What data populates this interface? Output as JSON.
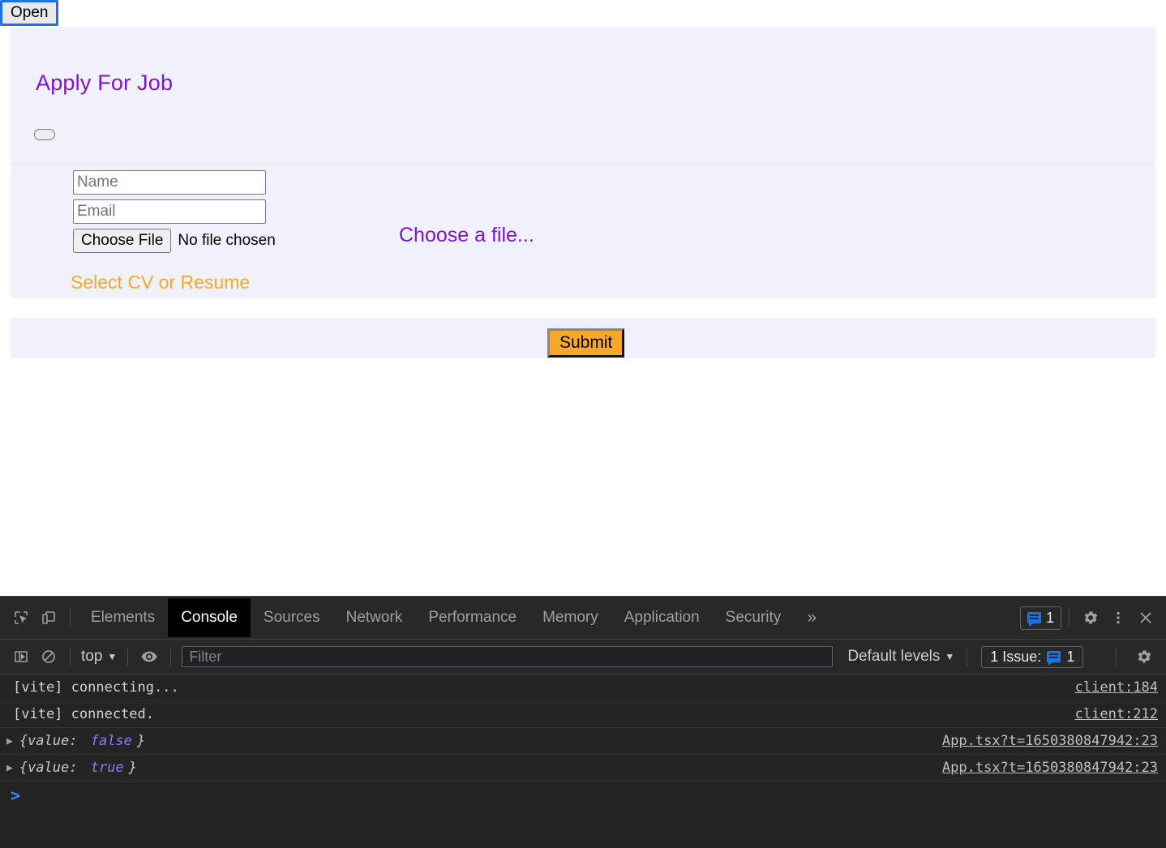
{
  "page": {
    "open_button": "Open",
    "modal": {
      "title": "Apply For Job",
      "pill_button_label": "",
      "name_placeholder": "Name",
      "email_placeholder": "Email",
      "name_value": "",
      "email_value": "",
      "choose_file_button": "Choose File",
      "no_file_chosen": "No file chosen",
      "choose_a_file_label": "Choose a file...",
      "select_cv_label": "Select CV or Resume",
      "submit_button": "Submit"
    },
    "colors": {
      "panel_bg": "#f0f1fd",
      "title_purple": "#7b16c9",
      "accent_orange": "#f7a825",
      "submit_bg": "#f7a82b",
      "focus_blue": "#1a73e8"
    }
  },
  "devtools": {
    "icons": {
      "inspect": "inspect-element-icon",
      "device": "device-toolbar-icon",
      "sidebar": "console-sidebar-icon",
      "clear": "clear-console-icon",
      "eye": "live-expression-icon",
      "settings": "gear-icon",
      "more": "kebab-menu-icon",
      "close": "close-icon",
      "message": "message-icon"
    },
    "tabs": [
      {
        "label": "Elements",
        "active": false
      },
      {
        "label": "Console",
        "active": true
      },
      {
        "label": "Sources",
        "active": false
      },
      {
        "label": "Network",
        "active": false
      },
      {
        "label": "Performance",
        "active": false
      },
      {
        "label": "Memory",
        "active": false
      },
      {
        "label": "Application",
        "active": false
      },
      {
        "label": "Security",
        "active": false
      }
    ],
    "more_tabs_label": "»",
    "issues_badge_count": "1",
    "filterbar": {
      "context": "top",
      "filter_placeholder": "Filter",
      "filter_value": "",
      "levels": "Default levels",
      "issue_label": "1 Issue:",
      "issue_count": "1"
    },
    "console_logs": [
      {
        "arrow": "",
        "text": "[vite] connecting...",
        "obj_prefix": "",
        "obj_value": "",
        "obj_suffix": "",
        "source": "client:184"
      },
      {
        "arrow": "",
        "text": "[vite] connected.",
        "obj_prefix": "",
        "obj_value": "",
        "obj_suffix": "",
        "source": "client:212"
      },
      {
        "arrow": "▶",
        "text": "",
        "obj_prefix": "{value: ",
        "obj_value": "false",
        "obj_suffix": "}",
        "source": "App.tsx?t=1650380847942:23"
      },
      {
        "arrow": "▶",
        "text": "",
        "obj_prefix": "{value: ",
        "obj_value": "true",
        "obj_suffix": "}",
        "source": "App.tsx?t=1650380847942:23"
      }
    ],
    "prompt_symbol": ">"
  }
}
